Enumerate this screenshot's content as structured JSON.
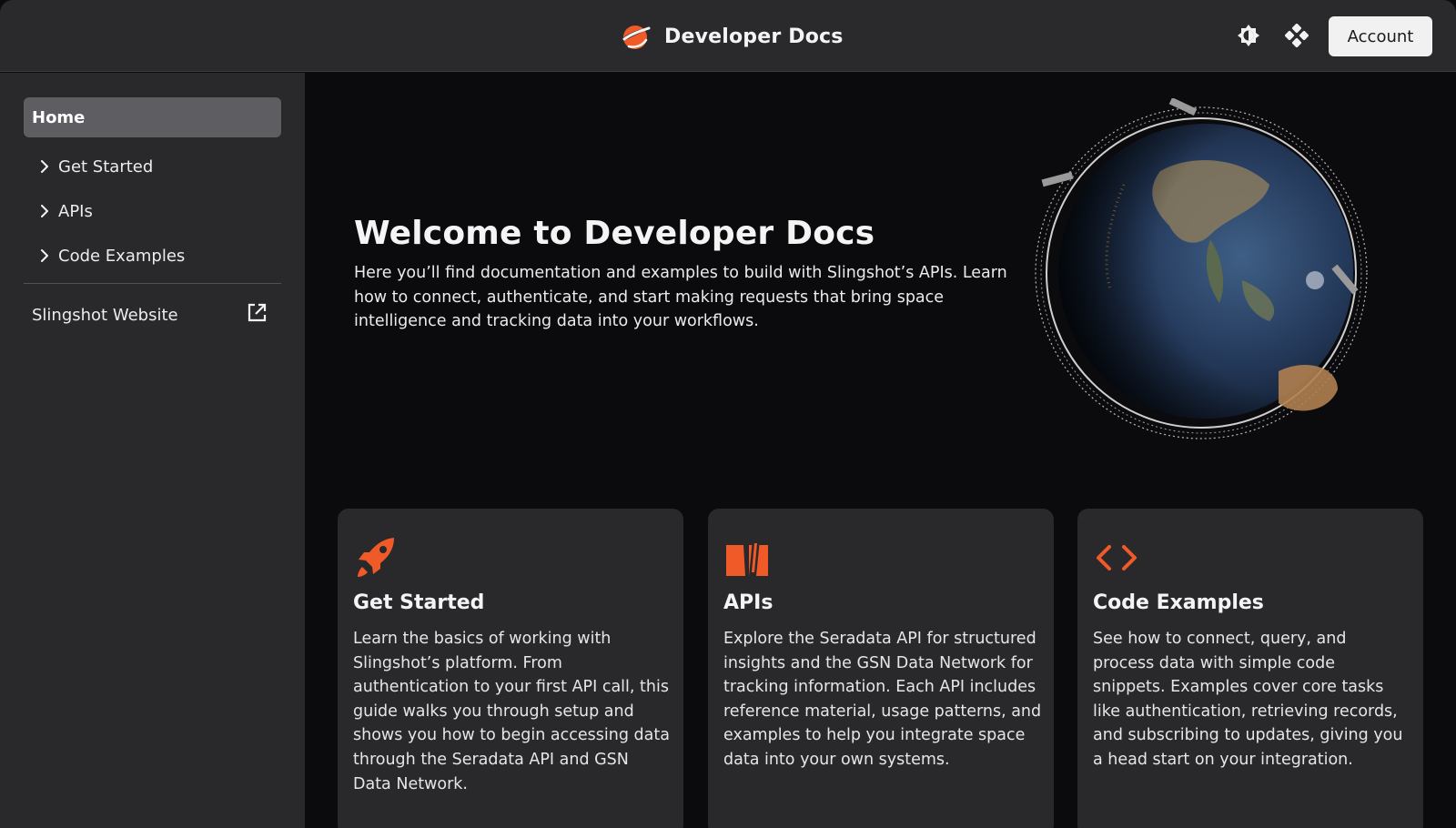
{
  "header": {
    "title": "Developer Docs",
    "logo_icon": "slingshot-logo-icon",
    "theme_icon": "theme-toggle-icon",
    "community_icon": "community-icon",
    "account_label": "Account"
  },
  "sidebar": {
    "home_label": "Home",
    "items": [
      {
        "label": "Get Started",
        "icon": "chevron-right-icon"
      },
      {
        "label": "APIs",
        "icon": "chevron-right-icon"
      },
      {
        "label": "Code Examples",
        "icon": "chevron-right-icon"
      }
    ],
    "external_link": {
      "label": "Slingshot Website",
      "icon": "external-link-icon"
    }
  },
  "hero": {
    "title": "Welcome to Developer Docs",
    "text": "Here you’ll find documentation and examples to build with Slingshot’s APIs. Learn how to connect, authenticate, and start making requests that bring space intelligence and tracking data into your workflows.",
    "image": "earth-globe-with-satellites"
  },
  "cards": [
    {
      "icon": "rocket-icon",
      "title": "Get Started",
      "body": "Learn the basics of working with Slingshot’s platform. From authentication to your first API call, this guide walks you through setup and shows you how to begin accessing data through the Seradata API and GSN Data Network."
    },
    {
      "icon": "book-icon",
      "title": "APIs",
      "body": "Explore the Seradata API for structured insights and the GSN Data Network for tracking information. Each API includes reference material, usage patterns, and examples to help you integrate space data into your own systems."
    },
    {
      "icon": "code-icon",
      "title": "Code Examples",
      "body": "See how to connect, query, and process data with simple code snippets. Examples cover core tasks like authentication, retrieving records, and subscribing to updates, giving you a head start on your integration."
    }
  ],
  "colors": {
    "accent": "#f05a28",
    "background": "#0b0b0d",
    "panel": "#29292c",
    "selected_nav": "#5e5e62"
  }
}
